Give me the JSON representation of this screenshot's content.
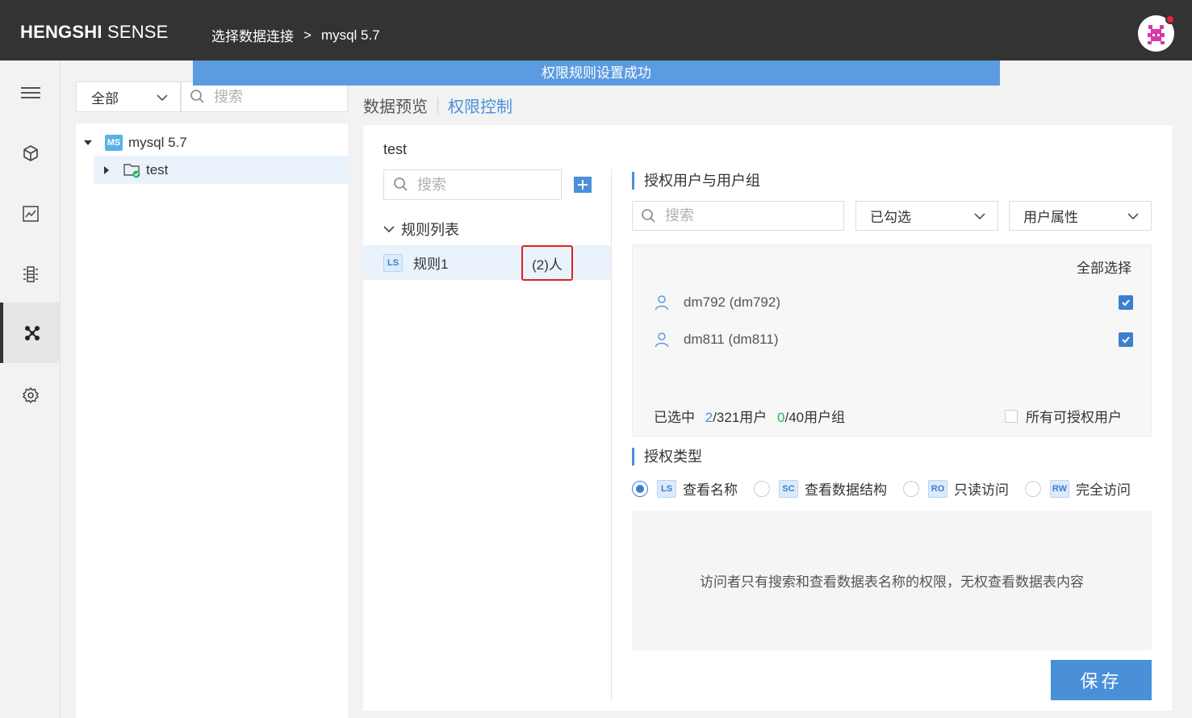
{
  "header": {
    "logo_bold": "HENGSHI",
    "logo_light": "SENSE",
    "breadcrumb": [
      "选择数据连接",
      ">",
      "mysql 5.7"
    ]
  },
  "toast": {
    "message": "权限规则设置成功"
  },
  "left_nav": {
    "items": [
      {
        "icon": "menu-icon"
      },
      {
        "icon": "cube-icon"
      },
      {
        "icon": "chart-icon"
      },
      {
        "icon": "dataset-icon"
      },
      {
        "icon": "connection-icon",
        "active": true
      },
      {
        "icon": "gear-icon"
      }
    ]
  },
  "sidebar": {
    "filter_value": "全部",
    "search_placeholder": "搜索",
    "tree": [
      {
        "label": "mysql 5.7",
        "badge": "MS",
        "expanded": true
      },
      {
        "label": "test",
        "selected": true
      }
    ]
  },
  "main_tabs": {
    "preview": "数据预览",
    "permission": "权限控制"
  },
  "panel": {
    "title": "test",
    "rule_search_placeholder": "搜索",
    "rules_header": "规则列表",
    "rules": [
      {
        "badge": "LS",
        "name": "规则1",
        "count": "(2)人"
      }
    ],
    "auth_users_title": "授权用户与用户组",
    "user_search_placeholder": "搜索",
    "checked_filter": "已勾选",
    "attr_filter": "用户属性",
    "select_all": "全部选择",
    "users": [
      {
        "name": "dm792 (dm792)",
        "checked": true
      },
      {
        "name": "dm811 (dm811)",
        "checked": true
      }
    ],
    "summary": {
      "prefix": "已选中",
      "users_selected": "2",
      "users_total": "/321用户",
      "groups_selected": "0",
      "groups_total": "/40用户组"
    },
    "all_authorized_label": "所有可授权用户",
    "auth_type_title": "授权类型",
    "auth_types": [
      {
        "badge": "LS",
        "label": "查看名称",
        "checked": true
      },
      {
        "badge": "SC",
        "label": "查看数据结构",
        "checked": false
      },
      {
        "badge": "RO",
        "label": "只读访问",
        "checked": false
      },
      {
        "badge": "RW",
        "label": "完全访问",
        "checked": false
      }
    ],
    "description": "访问者只有搜索和查看数据表名称的权限，无权查看数据表内容",
    "save_label": "保存"
  },
  "colors": {
    "accent": "#4a90d9",
    "topbar": "#333333",
    "highlight_box": "#e02020",
    "green": "#2db35e"
  }
}
